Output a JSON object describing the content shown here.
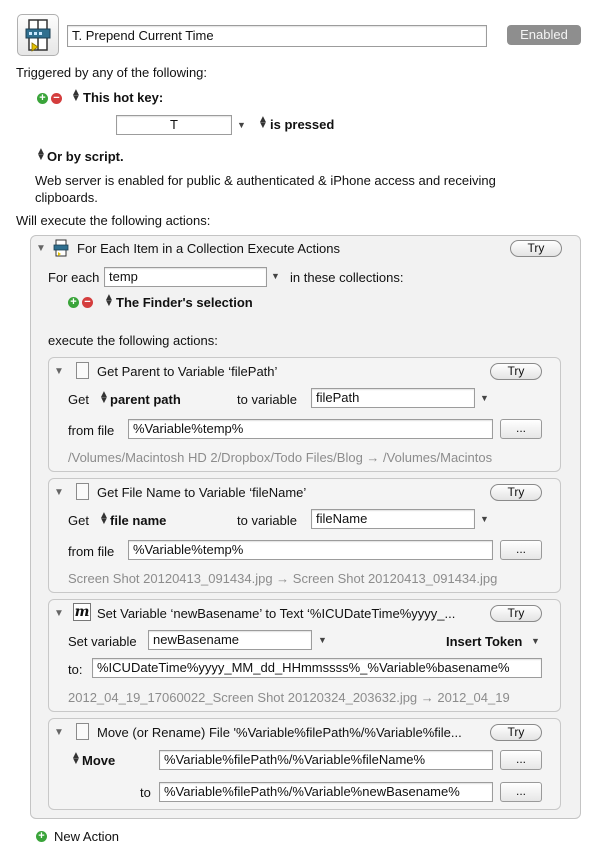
{
  "macro": {
    "name": "T. Prepend Current Time",
    "enabled_label": "Enabled"
  },
  "triggers": {
    "heading": "Triggered by any of the following:",
    "hotkey_label": "This hot key:",
    "hotkey_value": "T",
    "hotkey_state": "is pressed",
    "script_label": "Or by script.",
    "web_server_text": "Web server is enabled for public & authenticated & iPhone access and receiving clipboards."
  },
  "actions_heading": "Will execute the following actions:",
  "for_each": {
    "title": "For Each Item in a Collection Execute Actions",
    "try_label": "Try",
    "for_each_label": "For each",
    "variable_value": "temp",
    "collections_label": "in these collections:",
    "collection_item": "The Finder's selection",
    "execute_label": "execute the following actions:"
  },
  "action1": {
    "title": "Get Parent to Variable ‘filePath’",
    "try_label": "Try",
    "get_label": "Get",
    "get_option": "parent path",
    "to_variable_label": "to variable",
    "variable_value": "filePath",
    "from_file_label": "from file",
    "from_file_value": "%Variable%temp%",
    "browse_label": "...",
    "preview": "/Volumes/Macintosh HD 2/Dropbox/Todo Files/Blog → /Volumes/Macintos"
  },
  "action2": {
    "title": "Get File Name to Variable ‘fileName’",
    "try_label": "Try",
    "get_label": "Get",
    "get_option": "file name",
    "to_variable_label": "to variable",
    "variable_value": "fileName",
    "from_file_label": "from file",
    "from_file_value": "%Variable%temp%",
    "browse_label": "...",
    "preview": "Screen Shot 20120413_091434.jpg → Screen Shot 20120413_091434.jpg"
  },
  "action3": {
    "title": "Set Variable ‘newBasename’ to Text ‘%ICUDateTime%yyyy_...",
    "try_label": "Try",
    "set_variable_label": "Set variable",
    "variable_value": "newBasename",
    "insert_token_label": "Insert Token",
    "to_label": "to:",
    "to_value": "%ICUDateTime%yyyy_MM_dd_HHmmssss%_%Variable%basename%",
    "preview": "2012_04_19_17060022_Screen Shot 20120324_203632.jpg → 2012_04_19"
  },
  "action4": {
    "title": "Move (or Rename) File '%Variable%filePath%/%Variable%file...",
    "try_label": "Try",
    "move_label": "Move",
    "move_value": "%Variable%filePath%/%Variable%fileName%",
    "to_label": "to",
    "to_value": "%Variable%filePath%/%Variable%newBasename%",
    "browse_label": "..."
  },
  "new_action_label": "New Action",
  "colors": {
    "enabled_button": "#8e8e8e",
    "add_green": "#3aa43a",
    "remove_red": "#d43d3d",
    "panel_bg": "#f2f2f2"
  }
}
